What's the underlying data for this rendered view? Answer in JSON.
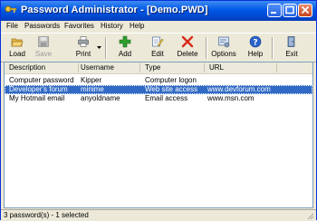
{
  "window": {
    "title": "Password Administrator - [Demo.PWD]"
  },
  "menu": [
    "File",
    "Passwords",
    "Favorites",
    "History",
    "Help"
  ],
  "toolbar": {
    "load": "Load",
    "save": "Save",
    "print": "Print",
    "add": "Add",
    "edit": "Edit",
    "delete": "Delete",
    "options": "Options",
    "help": "Help",
    "exit": "Exit"
  },
  "table": {
    "columns": [
      "Description",
      "Username",
      "Type",
      "URL"
    ],
    "rows": [
      {
        "description": "Computer password",
        "username": "Kipper",
        "type": "Computer logon",
        "url": ""
      },
      {
        "description": "Developer's forum",
        "username": "minime",
        "type": "Web site access",
        "url": "www.devforum.com"
      },
      {
        "description": "My Hotmail email",
        "username": "anyoldname",
        "type": "Email access",
        "url": "www.msn.com"
      }
    ],
    "selected_row": 1
  },
  "status": "3 password(s) - 1 selected",
  "colors": {
    "titlebar": "#0058e6",
    "selection": "#316ac5",
    "add_icon": "#2e9e2e",
    "delete_icon": "#d82a1a"
  },
  "icons": [
    "folder-open-icon",
    "save-disk-icon",
    "printer-icon",
    "plus-icon",
    "edit-icon",
    "delete-x-icon",
    "options-icon",
    "help-icon",
    "exit-door-icon"
  ]
}
